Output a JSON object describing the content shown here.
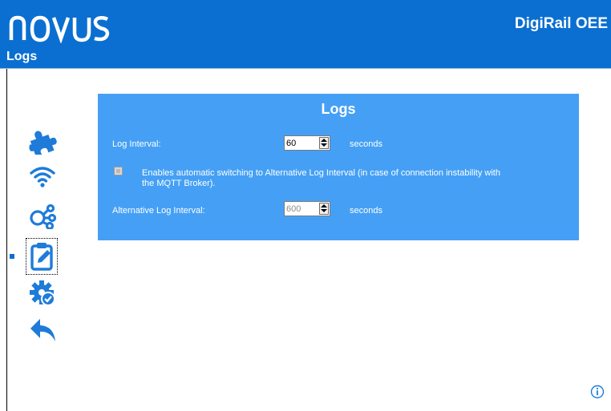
{
  "header": {
    "logo_text": "NOVUS",
    "product_name": "DigiRail OEE",
    "page_title": "Logs",
    "colors": {
      "bar": "#0a6fd1",
      "panel": "#45a0f5"
    }
  },
  "sidebar": {
    "items": [
      {
        "icon": "puzzle-icon",
        "active": false
      },
      {
        "icon": "wifi-icon",
        "active": false
      },
      {
        "icon": "network-icon",
        "active": false
      },
      {
        "icon": "clipboard-edit-icon",
        "active": true
      },
      {
        "icon": "gear-check-icon",
        "active": false
      },
      {
        "icon": "reply-arrow-icon",
        "active": false
      }
    ]
  },
  "panel": {
    "title": "Logs",
    "log_interval": {
      "label": "Log Interval:",
      "value": "60",
      "unit": "seconds"
    },
    "auto_switch": {
      "checked": false,
      "disabled": true,
      "label_line1": "Enables automatic switching to Alternative Log Interval (in case of connection instability with",
      "label_line2": "the MQTT Broker)."
    },
    "alt_log_interval": {
      "label": "Alternative Log Interval:",
      "value": "600",
      "unit": "seconds",
      "disabled": true
    }
  },
  "footer": {
    "icon": "info-icon"
  }
}
